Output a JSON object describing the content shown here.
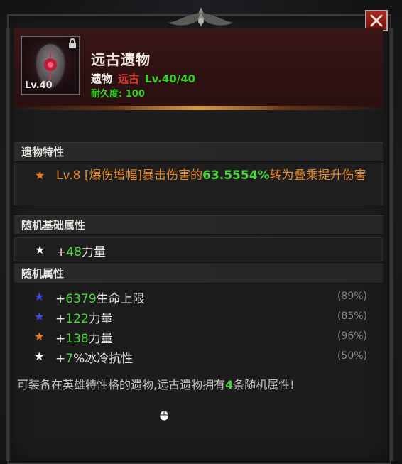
{
  "item": {
    "name": "远古遗物",
    "type": "遗物",
    "rarity": "远古",
    "level_text": "Lv.40/40",
    "durability": "耐久度: 100",
    "icon_level": "Lv.40",
    "icon": "relic-shield-icon"
  },
  "trait_section": {
    "title": "遗物特性",
    "trait": {
      "prefix": "Lv.8 [爆伤增幅]暴击伤害的",
      "value": "63.5554%",
      "suffix": "转为叠乘提升伤害"
    }
  },
  "base_section": {
    "title": "随机基础属性",
    "attr": {
      "plus": "+",
      "value": "48",
      "name": "力量"
    }
  },
  "random_section": {
    "title": "随机属性",
    "attrs": [
      {
        "plus": "+",
        "value": "6379",
        "name": "生命上限",
        "pct": "(89%)",
        "star_color": "#3a4fe0"
      },
      {
        "plus": "+",
        "value": "122",
        "name": "力量",
        "pct": "(85%)",
        "star_color": "#3a4fe0"
      },
      {
        "plus": "+",
        "value": "138",
        "name": "力量",
        "pct": "(96%)",
        "star_color": "#f07a1e"
      },
      {
        "plus": "+",
        "value": "7",
        "name": "%冰冷抗性",
        "pct": "(50%)",
        "star_color": "#ffffff"
      }
    ]
  },
  "footer": {
    "prefix": "可装备在英雄特性格的遗物,远古遗物拥有",
    "count": "4",
    "suffix": "条随机属性!"
  },
  "colors": {
    "rarity": "#e03a2b",
    "green": "#49d63a",
    "orange": "#e58a2c"
  }
}
